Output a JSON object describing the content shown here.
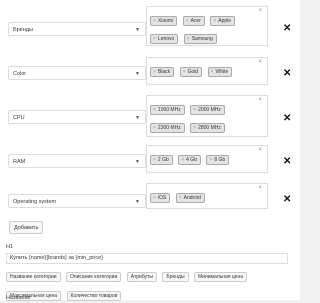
{
  "attributes": [
    {
      "label": "Бренды",
      "tags": [
        "Xiaomi",
        "Acer",
        "Apple",
        "Lenovo",
        "Samsung"
      ]
    },
    {
      "label": "Color",
      "tags": [
        "Black",
        "Gold",
        "White"
      ]
    },
    {
      "label": "CPU",
      "tags": [
        "1000 MHz",
        "2000 MHz",
        "2300 MHz",
        "2800 MHz"
      ]
    },
    {
      "label": "RAM",
      "tags": [
        "2 Gb",
        "4 Gb",
        "8 Gb"
      ]
    },
    {
      "label": "Operating system",
      "tags": [
        "iOS",
        "Android"
      ]
    }
  ],
  "add_button": "Добавить",
  "h1": {
    "label": "H1",
    "value": "Купить {name}{brands} за {min_price}"
  },
  "variables": [
    "Название категории",
    "Описание категории",
    "Атрибуты",
    "Бренды",
    "Минимальная цена",
    "Максимальная цена",
    "Количество товаров"
  ],
  "next_label": "Название"
}
